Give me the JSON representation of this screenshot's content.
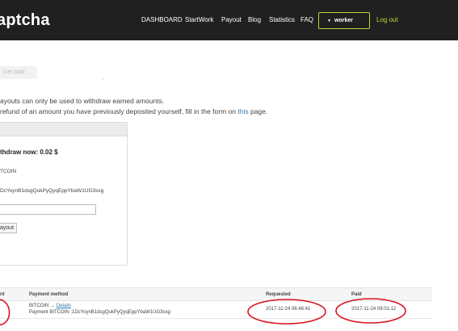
{
  "app": {
    "logo": "aptcha"
  },
  "nav": {
    "items": [
      "DASHBOARD",
      "StartWork",
      "Payout",
      "Blog",
      "Statistics",
      "FAQ"
    ],
    "user": "worker",
    "logout": "Log out"
  },
  "page": {
    "tab_label": "Get paid",
    "notice_line1": "ayouts can only be used to withdraw earned amounts.",
    "notice_line2_prefix": "refund of an amount you have previously deposited yourself, fill in the form on ",
    "notice_link": "this",
    "notice_line2_suffix": " page."
  },
  "withdraw_panel": {
    "title": "thdraw now: 0.02 $",
    "method": "TCOIN",
    "address": "DcYoynB1dsgQukPyQyqEppYbaW1UG3sxg",
    "amount_value": "",
    "button_label": "ayout"
  },
  "payments_table": {
    "headers": {
      "amount": "nt",
      "method": "Payment method",
      "requested": "Requested",
      "paid": "Paid"
    },
    "rows": [
      {
        "method_name": "BITCOIN",
        "arrow": "→",
        "details_link": "Details",
        "method_detail": "Payment BITCOIN :1DcYoynB1dsgQukPyQyqEppYbaW1UG3sxg",
        "requested": "2017-11-24 06:46:41",
        "paid": "2017-11-24 09:01:12"
      }
    ]
  },
  "annotations": {
    "color": "#d8141e"
  }
}
